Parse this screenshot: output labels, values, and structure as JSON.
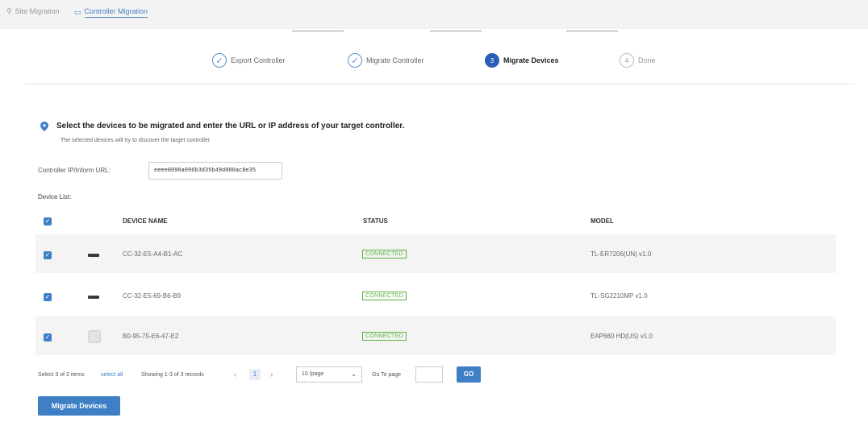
{
  "tabs": [
    {
      "label": "Site Migration",
      "icon": "pin-icon",
      "active": false
    },
    {
      "label": "Controller Migration",
      "icon": "controller-icon",
      "active": true
    }
  ],
  "stepper": [
    {
      "label": "Export Controller",
      "state": "done",
      "marker": "✓"
    },
    {
      "label": "Migrate Controller",
      "state": "done",
      "marker": "✓"
    },
    {
      "label": "Migrate Devices",
      "state": "current",
      "marker": "3"
    },
    {
      "label": "Done",
      "state": "todo",
      "marker": "4"
    }
  ],
  "notice": {
    "title": "Select the devices to be migrated and enter the URL or IP address of your target controller.",
    "subtitle": "The selected devices will try to discover the target controller."
  },
  "controller_url": {
    "label": "Controller IP/Inform URL:",
    "value": "eeee0098a096b3d35b49d080ac8e35"
  },
  "device_list": {
    "label": "Device List:",
    "columns": {
      "name": "DEVICE NAME",
      "status": "STATUS",
      "model": "MODEL"
    },
    "rows": [
      {
        "name": "CC-32-E5-A4-B1-AC",
        "status": "CONNECTED",
        "model": "TL-ER7206(UN) v1.0",
        "checked": true,
        "icon": "gateway-icon"
      },
      {
        "name": "CC-32-E5-69-B6-B9",
        "status": "CONNECTED",
        "model": "TL-SG2210MP v1.0",
        "checked": true,
        "icon": "switch-icon"
      },
      {
        "name": "B0-95-75-E6-47-E2",
        "status": "CONNECTED",
        "model": "EAP660 HD(US) v1.0",
        "checked": true,
        "icon": "access-point-icon"
      }
    ]
  },
  "footer": {
    "selected_text": "Select 3 of 3 items",
    "select_all": "select all",
    "showing": "Showing 1-3 of 3 records",
    "current_page": "1",
    "per_page": "10 /page",
    "goto_label": "Go To page",
    "go_button": "GO"
  },
  "migrate_button": "Migrate Devices",
  "colors": {
    "accent": "#3e7fc5",
    "status_ok": "#5ab33d",
    "step_current": "#2a5eb8"
  }
}
